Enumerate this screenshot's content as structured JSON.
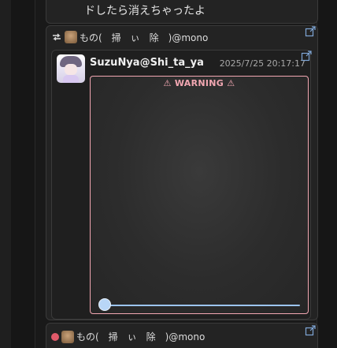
{
  "top_note": {
    "text": "ドしたら消えちゃったよ"
  },
  "renote": {
    "user_display": "もの(　掃　ぃ　除　)@mono",
    "inner": {
      "username": "SuzuNya@Shi_ta_ya",
      "timestamp": "2025/7/25 20:17:17",
      "warning_label": "WARNING",
      "warning_icon": "⚠",
      "slider_value": 0
    }
  },
  "renote2": {
    "user_display": "もの(　掃　ぃ　除　)@mono"
  },
  "colors": {
    "warning": "#f2a7b2",
    "slider": "#9cc4f0",
    "bg": "#191919"
  }
}
